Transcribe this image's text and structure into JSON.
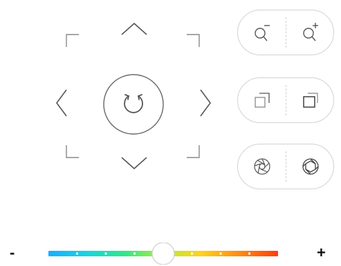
{
  "controls": {
    "zoom": {
      "out_icon": "zoom-out-icon",
      "in_icon": "zoom-in-icon"
    },
    "window": {
      "restore_icon": "window-restore-icon",
      "maximize_icon": "window-maximize-icon"
    },
    "aperture": {
      "close_icon": "aperture-close-icon",
      "open_icon": "aperture-open-icon"
    }
  },
  "dpad": {
    "up_icon": "chevron-up-icon",
    "down_icon": "chevron-down-icon",
    "left_icon": "chevron-left-icon",
    "right_icon": "chevron-right-icon",
    "center_icon": "refresh-icon"
  },
  "slider": {
    "minus_label": "-",
    "plus_label": "+",
    "value": 0.5,
    "tick_count": 7,
    "gradient_colors": [
      "#18aeff",
      "#19d4e0",
      "#2ee88a",
      "#b6ec3a",
      "#ffd21a",
      "#ff8a12",
      "#ff3d0a"
    ],
    "thumb_color": "#ffffff",
    "tick_color": "#ffffff"
  },
  "colors": {
    "icon_stroke": "#555555",
    "pill_border": "#d2d2d2",
    "divider": "#cfcfcf"
  }
}
